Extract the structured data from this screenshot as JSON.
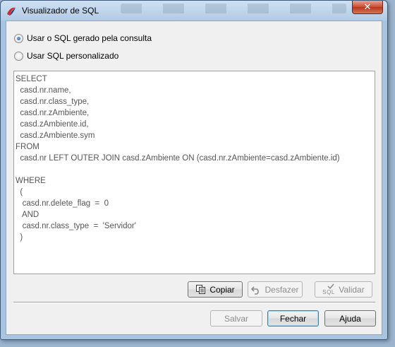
{
  "window": {
    "title": "Visualizador de SQL",
    "close_glyph": "✕"
  },
  "options": [
    {
      "label": "Usar o SQL gerado pela consulta",
      "checked": true
    },
    {
      "label": "Usar SQL personalizado",
      "checked": false
    }
  ],
  "sql_text": "SELECT\n  casd.nr.name,\n  casd.nr.class_type,\n  casd.nr.zAmbiente,\n  casd.zAmbiente.id,\n  casd.zAmbiente.sym\nFROM\n  casd.nr LEFT OUTER JOIN casd.zAmbiente ON (casd.nr.zAmbiente=casd.zAmbiente.id)\n\nWHERE\n  (\n   casd.nr.delete_flag  =  0\n   AND\n   casd.nr.class_type  =  'Servidor'\n  )",
  "editor_buttons": {
    "copy": {
      "label": "Copiar",
      "icon": "copy-icon",
      "enabled": true
    },
    "undo": {
      "label": "Desfazer",
      "icon": "undo-icon",
      "enabled": false
    },
    "validate": {
      "label": "Validar",
      "icon": "sql-validate-icon",
      "icon_text": "SQL",
      "enabled": false
    }
  },
  "footer_buttons": {
    "save": {
      "label": "Salvar",
      "enabled": false
    },
    "close": {
      "label": "Fechar",
      "enabled": true,
      "default": true
    },
    "help": {
      "label": "Ajuda",
      "enabled": true
    }
  },
  "colors": {
    "titlebar": "#b2cbe6",
    "close_button": "#c84b31",
    "default_button_border": "#3c7fb1"
  }
}
